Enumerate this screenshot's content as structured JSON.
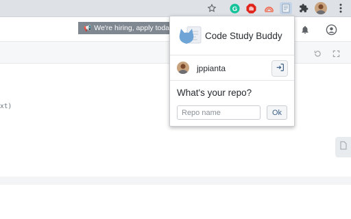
{
  "browser": {
    "extensions": [
      "star-icon",
      "grammarly-icon",
      "adblock-icon",
      "dome-icon",
      "code-study-buddy-icon",
      "puzzle-icon",
      "profile-avatar",
      "menu-kebab-icon"
    ]
  },
  "page": {
    "banner_text": "We're hiring, apply toda",
    "code_snippet": "xt)",
    "header_icons": [
      "bell-icon",
      "user-circle-icon"
    ]
  },
  "popup": {
    "title": "Code Study Buddy",
    "username": "jppianta",
    "repo_question": "What's your repo?",
    "repo_input": {
      "value": "",
      "placeholder": "Repo name"
    },
    "ok_label": "Ok"
  },
  "colors": {
    "toolbar": "#dee1e6",
    "banner": "#7f8790",
    "logo_blue": "#6ea4d6",
    "ok_text": "#3b5f86"
  }
}
